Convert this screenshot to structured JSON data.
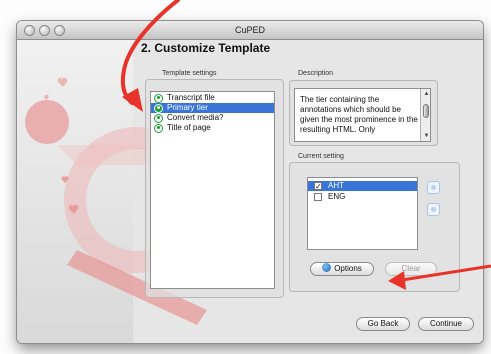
{
  "window": {
    "title": "CuPED"
  },
  "page": {
    "heading": "2. Customize Template"
  },
  "template_settings": {
    "label": "Template settings",
    "items": [
      {
        "label": "Transcript file",
        "selected": false
      },
      {
        "label": "Primary tier",
        "selected": true
      },
      {
        "label": "Convert media?",
        "selected": false
      },
      {
        "label": "Title of page",
        "selected": false
      }
    ]
  },
  "description": {
    "label": "Description",
    "text": "The tier containing the annotations which should be given the most prominence in the resulting HTML.  Only"
  },
  "current_setting": {
    "label": "Current setting",
    "tiers": [
      {
        "label": "AHT",
        "checked": true,
        "selected": true
      },
      {
        "label": "ENG",
        "checked": false,
        "selected": false
      }
    ],
    "options_button": "Options",
    "clear_button": "Clear"
  },
  "footer": {
    "go_back_button": "Go Back",
    "continue_button": "Continue"
  },
  "colors": {
    "annotation_arrow": "#e8332a",
    "selection": "#3875d7",
    "setting_dot": "#1a9f30",
    "watermark": "#e87f7f"
  }
}
